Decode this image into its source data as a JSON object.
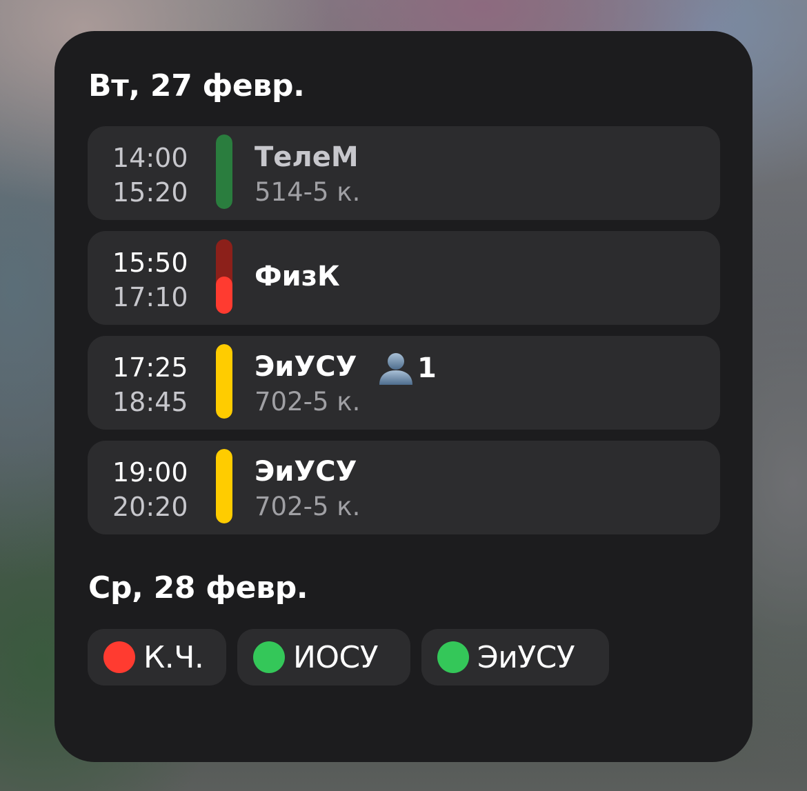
{
  "days": [
    {
      "header": "Вт, 27 февр.",
      "events": [
        {
          "start": "14:00",
          "end": "15:20",
          "title": "ТелеМ",
          "room": "514-5 к.",
          "color": "#2a7d3e",
          "progress": 1.0,
          "start_color": "#c7c7cc",
          "end_color": "#c7c7cc",
          "title_color": "#c7c7cc",
          "status": "past"
        },
        {
          "start": "15:50",
          "end": "17:10",
          "title": "ФизК",
          "room": "",
          "color": "#ff3b30",
          "progress": 0.5,
          "start_color": "#ffffff",
          "end_color": "#c7c7cc",
          "title_color": "#ffffff",
          "status": "current"
        },
        {
          "start": "17:25",
          "end": "18:45",
          "title": "ЭиУСУ",
          "room": "702-5 к.",
          "color": "#ffcc00",
          "progress": 1.0,
          "start_color": "#ffffff",
          "end_color": "#c7c7cc",
          "title_color": "#ffffff",
          "status": "upcoming",
          "attendee_icon": "person-icon",
          "attendee_count": "1"
        },
        {
          "start": "19:00",
          "end": "20:20",
          "title": "ЭиУСУ",
          "room": "702-5 к.",
          "color": "#ffcc00",
          "progress": 1.0,
          "start_color": "#ffffff",
          "end_color": "#c7c7cc",
          "title_color": "#ffffff",
          "status": "upcoming"
        }
      ]
    },
    {
      "header": "Ср, 28 февр.",
      "chips": [
        {
          "label": "К.Ч.",
          "color": "#ff3b30"
        },
        {
          "label": "ИОСУ",
          "color": "#34c759"
        },
        {
          "label": "ЭиУСУ",
          "color": "#34c759"
        }
      ]
    }
  ]
}
